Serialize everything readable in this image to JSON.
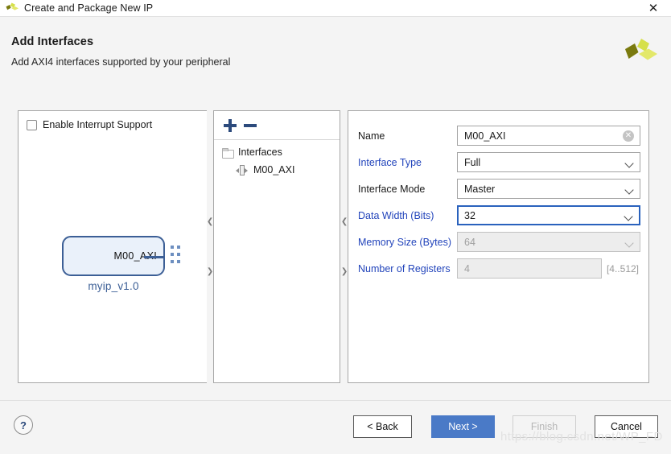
{
  "window": {
    "title": "Create and Package New IP",
    "close_icon": "close-icon",
    "app_logo": "xilinx-logo"
  },
  "header": {
    "title": "Add Interfaces",
    "subtitle": "Add AXI4 interfaces supported by your peripheral",
    "logo": "xilinx-logo"
  },
  "left_panel": {
    "interrupt_checkbox": {
      "label": "Enable Interrupt Support",
      "checked": false
    },
    "ip_block": {
      "port_label": "M00_AXI",
      "module_name": "myip_v1.0"
    }
  },
  "middle_panel": {
    "toolbar": {
      "add_icon": "plus-icon",
      "remove_icon": "minus-icon"
    },
    "tree": {
      "root_label": "Interfaces",
      "root_icon": "folder-icon",
      "children": [
        {
          "label": "M00_AXI",
          "icon": "interface-icon"
        }
      ]
    }
  },
  "right_panel": {
    "fields": [
      {
        "label": "Name",
        "value": "M00_AXI",
        "kind": "text",
        "label_color": "#1a1a1a",
        "disabled": false,
        "focused": false,
        "clear_icon": "clear-icon"
      },
      {
        "label": "Interface Type",
        "value": "Full",
        "kind": "select",
        "label_color": "#2244bb",
        "disabled": false,
        "focused": false
      },
      {
        "label": "Interface Mode",
        "value": "Master",
        "kind": "select",
        "label_color": "#1a1a1a",
        "disabled": false,
        "focused": false
      },
      {
        "label": "Data Width (Bits)",
        "value": "32",
        "kind": "select",
        "label_color": "#2244bb",
        "disabled": false,
        "focused": true
      },
      {
        "label": "Memory Size (Bytes)",
        "value": "64",
        "kind": "select",
        "label_color": "#2244bb",
        "disabled": true,
        "focused": false
      },
      {
        "label": "Number of Registers",
        "value": "4",
        "kind": "text",
        "label_color": "#2244bb",
        "disabled": true,
        "focused": false,
        "hint": "[4..512]"
      }
    ]
  },
  "splitters": {
    "collapse_left_icon": "chevron-left-icon",
    "collapse_right_icon": "chevron-right-icon"
  },
  "footer": {
    "help_label": "?",
    "buttons": {
      "back": "< Back",
      "next": "Next >",
      "finish": "Finish",
      "cancel": "Cancel"
    }
  },
  "watermark": "https://blog.csdn.net/WP_FD",
  "colors": {
    "accent_blue": "#4a7ac7",
    "link_blue": "#2244bb",
    "ip_border": "#3c5f96",
    "logo_bright": "#d6e04a",
    "logo_dark": "#7a7a0e",
    "logo_light": "#e3e86a"
  }
}
